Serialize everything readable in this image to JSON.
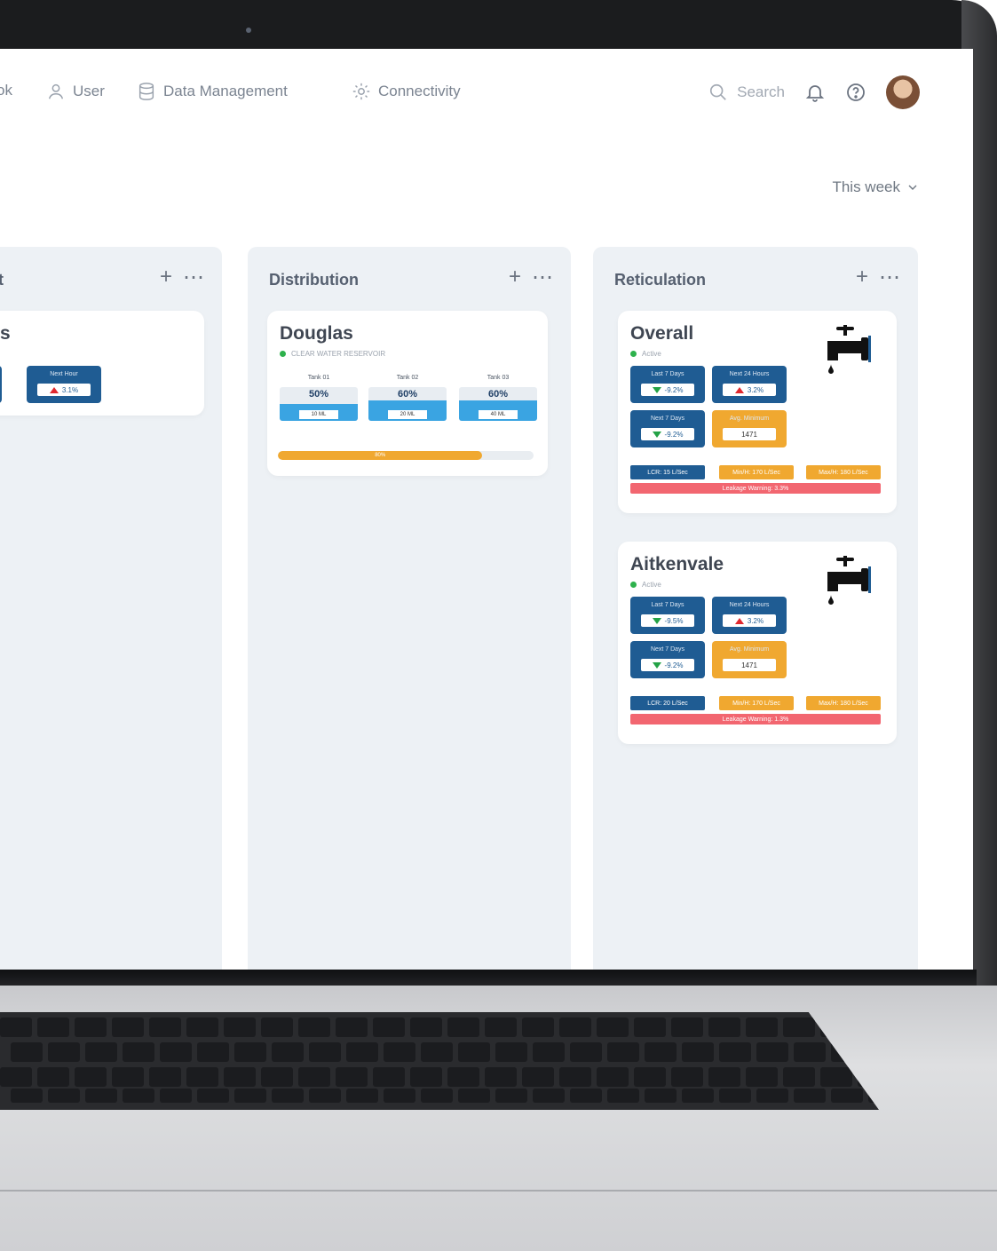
{
  "nav": {
    "items": [
      {
        "label": "ok",
        "icon": "book-icon"
      },
      {
        "label": "User",
        "icon": "user-icon"
      },
      {
        "label": "Data Management",
        "icon": "database-icon"
      },
      {
        "label": "Connectivity",
        "icon": "gear-icon"
      }
    ],
    "search_placeholder": "Search"
  },
  "range": {
    "label": "This week"
  },
  "columns": [
    {
      "title": "t",
      "card": {
        "title": "s",
        "tile": {
          "label": "Next Hour",
          "value": "3.1%"
        }
      }
    },
    {
      "title": "Distribution",
      "card": {
        "title": "Douglas",
        "status": "CLEAR WATER RESERVOIR",
        "tanks": [
          {
            "name": "Tank 01",
            "percent": "50%",
            "volume": "10 ML",
            "level": 0.5
          },
          {
            "name": "Tank 02",
            "percent": "60%",
            "volume": "20 ML",
            "level": 0.6
          },
          {
            "name": "Tank 03",
            "percent": "60%",
            "volume": "40 ML",
            "level": 0.6
          }
        ],
        "progress": {
          "label": "80%",
          "value": 0.8
        }
      }
    },
    {
      "title": "Reticulation",
      "cards": [
        {
          "title": "Overall",
          "status": "Active",
          "tiles": [
            {
              "label": "Last 7 Days",
              "value": "-9.2%",
              "trend": "down"
            },
            {
              "label": "Next 24 Hours",
              "value": "3.2%",
              "trend": "up"
            },
            {
              "label": "Next 7 Days",
              "value": "-9.2%",
              "trend": "down"
            },
            {
              "label": "Avg. Minimum",
              "value": "1471",
              "trend": "none"
            }
          ],
          "pills": [
            "LCR: 15 L/Sec",
            "Min/H: 170 L/Sec",
            "Max/H: 180 L/Sec"
          ],
          "alert": "Leakage Warning: 3.3%"
        },
        {
          "title": "Aitkenvale",
          "status": "Active",
          "tiles": [
            {
              "label": "Last 7 Days",
              "value": "-9.5%",
              "trend": "down"
            },
            {
              "label": "Next 24 Hours",
              "value": "3.2%",
              "trend": "up"
            },
            {
              "label": "Next 7 Days",
              "value": "-9.2%",
              "trend": "down"
            },
            {
              "label": "Avg. Minimum",
              "value": "1471",
              "trend": "none"
            }
          ],
          "pills": [
            "LCR: 20 L/Sec",
            "Min/H: 170 L/Sec",
            "Max/H: 180 L/Sec"
          ],
          "alert": "Leakage Warning: 1.3%"
        }
      ]
    }
  ],
  "colors": {
    "blue": "#1f5c93",
    "orange": "#f0a830",
    "red": "#f26670",
    "tank": "#3aa4e2",
    "active": "#2db14c"
  }
}
